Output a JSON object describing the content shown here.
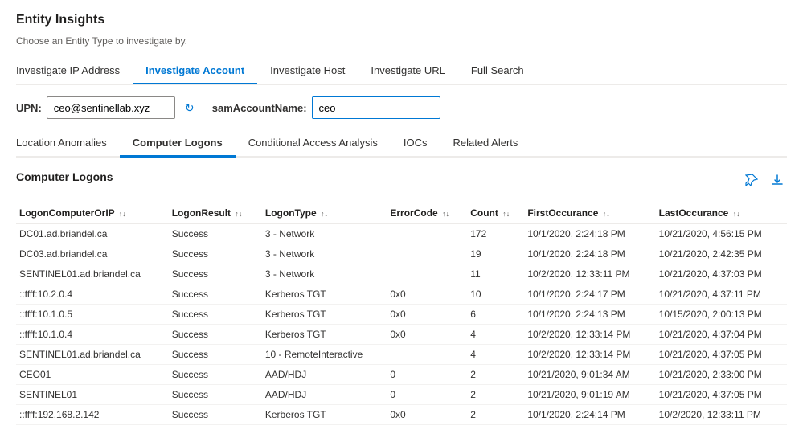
{
  "page": {
    "title": "Entity Insights",
    "subtitle": "Choose an Entity Type to investigate by."
  },
  "nav_tabs": [
    {
      "id": "investigate-ip",
      "label": "Investigate IP Address",
      "active": false
    },
    {
      "id": "investigate-account",
      "label": "Investigate Account",
      "active": true
    },
    {
      "id": "investigate-host",
      "label": "Investigate Host",
      "active": false
    },
    {
      "id": "investigate-url",
      "label": "Investigate URL",
      "active": false
    },
    {
      "id": "full-search",
      "label": "Full Search",
      "active": false
    }
  ],
  "inputs": {
    "upn_label": "UPN:",
    "upn_value": "ceo@sentinellab.xyz",
    "sam_label": "samAccountName:",
    "sam_value": "ceo"
  },
  "sub_tabs": [
    {
      "id": "location-anomalies",
      "label": "Location Anomalies",
      "active": false
    },
    {
      "id": "computer-logons",
      "label": "Computer Logons",
      "active": true
    },
    {
      "id": "conditional-access",
      "label": "Conditional Access Analysis",
      "active": false
    },
    {
      "id": "iocs",
      "label": "IOCs",
      "active": false
    },
    {
      "id": "related-alerts",
      "label": "Related Alerts",
      "active": false
    }
  ],
  "section_title": "Computer Logons",
  "table": {
    "columns": [
      {
        "id": "logon-computer",
        "label": "LogonComputerOrIP",
        "sortable": true
      },
      {
        "id": "logon-result",
        "label": "LogonResult",
        "sortable": true
      },
      {
        "id": "logon-type",
        "label": "LogonType",
        "sortable": true
      },
      {
        "id": "error-code",
        "label": "ErrorCode",
        "sortable": true
      },
      {
        "id": "count",
        "label": "Count",
        "sortable": true
      },
      {
        "id": "first-occurrence",
        "label": "FirstOccurance",
        "sortable": true
      },
      {
        "id": "last-occurrence",
        "label": "LastOccurance",
        "sortable": true
      }
    ],
    "rows": [
      {
        "logon_computer": "DC01.ad.briandel.ca",
        "logon_result": "Success",
        "logon_type": "3 - Network",
        "error_code": "",
        "count": "172",
        "first_occurrence": "10/1/2020, 2:24:18 PM",
        "last_occurrence": "10/21/2020, 4:56:15 PM"
      },
      {
        "logon_computer": "DC03.ad.briandel.ca",
        "logon_result": "Success",
        "logon_type": "3 - Network",
        "error_code": "",
        "count": "19",
        "first_occurrence": "10/1/2020, 2:24:18 PM",
        "last_occurrence": "10/21/2020, 2:42:35 PM"
      },
      {
        "logon_computer": "SENTINEL01.ad.briandel.ca",
        "logon_result": "Success",
        "logon_type": "3 - Network",
        "error_code": "",
        "count": "11",
        "first_occurrence": "10/2/2020, 12:33:11 PM",
        "last_occurrence": "10/21/2020, 4:37:03 PM"
      },
      {
        "logon_computer": "::ffff:10.2.0.4",
        "logon_result": "Success",
        "logon_type": "Kerberos TGT",
        "error_code": "0x0",
        "count": "10",
        "first_occurrence": "10/1/2020, 2:24:17 PM",
        "last_occurrence": "10/21/2020, 4:37:11 PM"
      },
      {
        "logon_computer": "::ffff:10.1.0.5",
        "logon_result": "Success",
        "logon_type": "Kerberos TGT",
        "error_code": "0x0",
        "count": "6",
        "first_occurrence": "10/1/2020, 2:24:13 PM",
        "last_occurrence": "10/15/2020, 2:00:13 PM"
      },
      {
        "logon_computer": "::ffff:10.1.0.4",
        "logon_result": "Success",
        "logon_type": "Kerberos TGT",
        "error_code": "0x0",
        "count": "4",
        "first_occurrence": "10/2/2020, 12:33:14 PM",
        "last_occurrence": "10/21/2020, 4:37:04 PM"
      },
      {
        "logon_computer": "SENTINEL01.ad.briandel.ca",
        "logon_result": "Success",
        "logon_type": "10 - RemoteInteractive",
        "error_code": "",
        "count": "4",
        "first_occurrence": "10/2/2020, 12:33:14 PM",
        "last_occurrence": "10/21/2020, 4:37:05 PM"
      },
      {
        "logon_computer": "CEO01",
        "logon_result": "Success",
        "logon_type": "AAD/HDJ",
        "error_code": "0",
        "count": "2",
        "first_occurrence": "10/21/2020, 9:01:34 AM",
        "last_occurrence": "10/21/2020, 2:33:00 PM"
      },
      {
        "logon_computer": "SENTINEL01",
        "logon_result": "Success",
        "logon_type": "AAD/HDJ",
        "error_code": "0",
        "count": "2",
        "first_occurrence": "10/21/2020, 9:01:19 AM",
        "last_occurrence": "10/21/2020, 4:37:05 PM"
      },
      {
        "logon_computer": "::ffff:192.168.2.142",
        "logon_result": "Success",
        "logon_type": "Kerberos TGT",
        "error_code": "0x0",
        "count": "2",
        "first_occurrence": "10/1/2020, 2:24:14 PM",
        "last_occurrence": "10/2/2020, 12:33:11 PM"
      }
    ]
  },
  "icons": {
    "refresh": "↻",
    "pin": "📌",
    "download": "⬇",
    "sort": "↑↓"
  }
}
